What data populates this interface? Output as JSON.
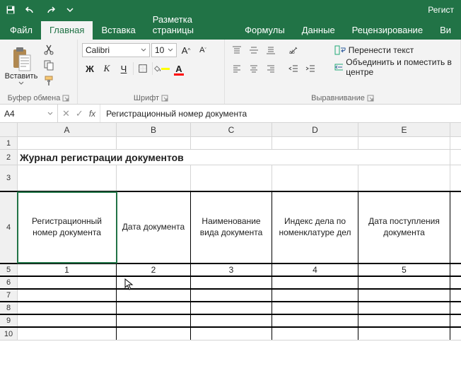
{
  "titlebar": {
    "title_right": "Регист"
  },
  "tabs": {
    "file": "Файл",
    "home": "Главная",
    "insert": "Вставка",
    "pagelayout": "Разметка страницы",
    "formulas": "Формулы",
    "data": "Данные",
    "review": "Рецензирование",
    "view": "Ви"
  },
  "ribbon": {
    "clipboard": {
      "paste": "Вставить",
      "group": "Буфер обмена"
    },
    "font": {
      "name": "Calibri",
      "size": "10",
      "group": "Шрифт",
      "bold": "Ж",
      "italic": "К",
      "underline": "Ч"
    },
    "align": {
      "wrap": "Перенести текст",
      "merge": "Объединить и поместить в центре",
      "group": "Выравнивание"
    }
  },
  "fx": {
    "namebox": "A4",
    "fx_label": "fx",
    "formula": "Регистрационный номер документа"
  },
  "grid": {
    "cols": [
      "A",
      "B",
      "C",
      "D",
      "E"
    ],
    "row2_title": "Журнал регистрации документов",
    "row4": [
      "Регистрационный номер документа",
      "Дата документа",
      "Наименование вида документа",
      "Индекс дела по номенклатуре дел",
      "Дата поступления документа"
    ],
    "row5": [
      "1",
      "2",
      "3",
      "4",
      "5"
    ],
    "rownums": [
      "1",
      "2",
      "3",
      "4",
      "5",
      "6",
      "7",
      "8",
      "9",
      "10"
    ]
  }
}
